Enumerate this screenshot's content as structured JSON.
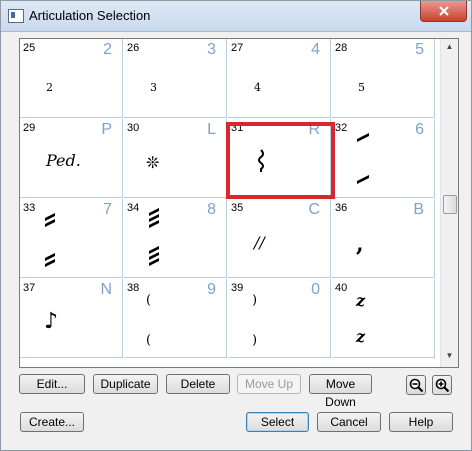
{
  "window": {
    "title": "Articulation Selection",
    "close_label": "x"
  },
  "cells": [
    {
      "num": "25",
      "key": "2",
      "sym": "2"
    },
    {
      "num": "26",
      "key": "3",
      "sym": "3"
    },
    {
      "num": "27",
      "key": "4",
      "sym": "4"
    },
    {
      "num": "28",
      "key": "5",
      "sym": "5"
    },
    {
      "num": "29",
      "key": "P",
      "sym": "Ped."
    },
    {
      "num": "30",
      "key": "L",
      "sym": "❊"
    },
    {
      "num": "31",
      "key": "R",
      "sym": "⌇"
    },
    {
      "num": "32",
      "key": "6",
      "sym": "tremolo-single"
    },
    {
      "num": "33",
      "key": "7",
      "sym": "tremolo-double"
    },
    {
      "num": "34",
      "key": "8",
      "sym": "tremolo-triple"
    },
    {
      "num": "35",
      "key": "C",
      "sym": "//"
    },
    {
      "num": "36",
      "key": "B",
      "sym": ","
    },
    {
      "num": "37",
      "key": "N",
      "sym": "♪"
    },
    {
      "num": "38",
      "key": "9",
      "sym": "("
    },
    {
      "num": "39",
      "key": "0",
      "sym": ")"
    },
    {
      "num": "40",
      "key": "",
      "sym": "z"
    }
  ],
  "selected_cell": "31",
  "toolbar": {
    "edit": "Edit...",
    "duplicate": "Duplicate",
    "delete": "Delete",
    "move_up": "Move Up",
    "move_down": "Move Down"
  },
  "footer": {
    "create": "Create...",
    "select": "Select",
    "cancel": "Cancel",
    "help": "Help"
  },
  "colors": {
    "selection": "#d9262f",
    "key_text": "#7ea2c8",
    "grid_line": "#b9cfe0"
  }
}
